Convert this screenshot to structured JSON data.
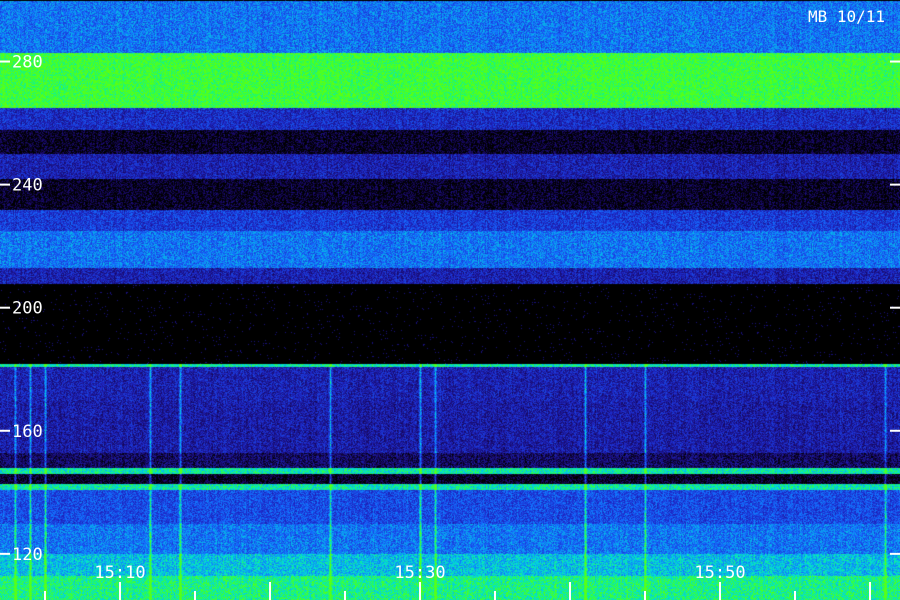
{
  "colors": {
    "background": "#000000",
    "text": "#ffffff",
    "low": "#1a0a6e",
    "mid": "#1e4bff",
    "high": "#00e0e0",
    "peak": "#33ff33"
  },
  "chart_data": {
    "type": "heatmap",
    "title": "MB 10/11",
    "xlabel": "",
    "ylabel": "",
    "x_axis": {
      "tick_labels": [
        "15:10",
        "15:30",
        "15:50"
      ],
      "range_minutes": [
        "15:02",
        "16:02"
      ]
    },
    "y_axis": {
      "tick_values": [
        120,
        160,
        200,
        240,
        280
      ],
      "tick_labels": [
        "120",
        "160",
        "200",
        "240",
        "280"
      ],
      "range": [
        105,
        300
      ]
    },
    "bands": [
      {
        "from": 283,
        "to": 300,
        "level": 0.55
      },
      {
        "from": 265,
        "to": 283,
        "level": 0.95
      },
      {
        "from": 258,
        "to": 265,
        "level": 0.35
      },
      {
        "from": 250,
        "to": 258,
        "level": 0.05
      },
      {
        "from": 242,
        "to": 250,
        "level": 0.3
      },
      {
        "from": 232,
        "to": 242,
        "level": 0.05
      },
      {
        "from": 225,
        "to": 232,
        "level": 0.4
      },
      {
        "from": 213,
        "to": 225,
        "level": 0.55
      },
      {
        "from": 208,
        "to": 213,
        "level": 0.3
      },
      {
        "from": 182,
        "to": 208,
        "level": 0.0
      },
      {
        "from": 181,
        "to": 182,
        "level": 0.8
      },
      {
        "from": 170,
        "to": 181,
        "level": 0.3
      },
      {
        "from": 153,
        "to": 170,
        "level": 0.28
      },
      {
        "from": 148,
        "to": 153,
        "level": 0.15
      },
      {
        "from": 146,
        "to": 148,
        "level": 0.8
      },
      {
        "from": 143,
        "to": 146,
        "level": 0.05
      },
      {
        "from": 141,
        "to": 143,
        "level": 0.8
      },
      {
        "from": 130,
        "to": 141,
        "level": 0.45
      },
      {
        "from": 120,
        "to": 130,
        "level": 0.55
      },
      {
        "from": 113,
        "to": 120,
        "level": 0.7
      },
      {
        "from": 105,
        "to": 113,
        "level": 0.85
      }
    ],
    "vertical_bursts_at": [
      "15:03",
      "15:04",
      "15:05",
      "15:12",
      "15:14",
      "15:24",
      "15:30",
      "15:31",
      "15:41",
      "15:45",
      "16:01"
    ]
  }
}
